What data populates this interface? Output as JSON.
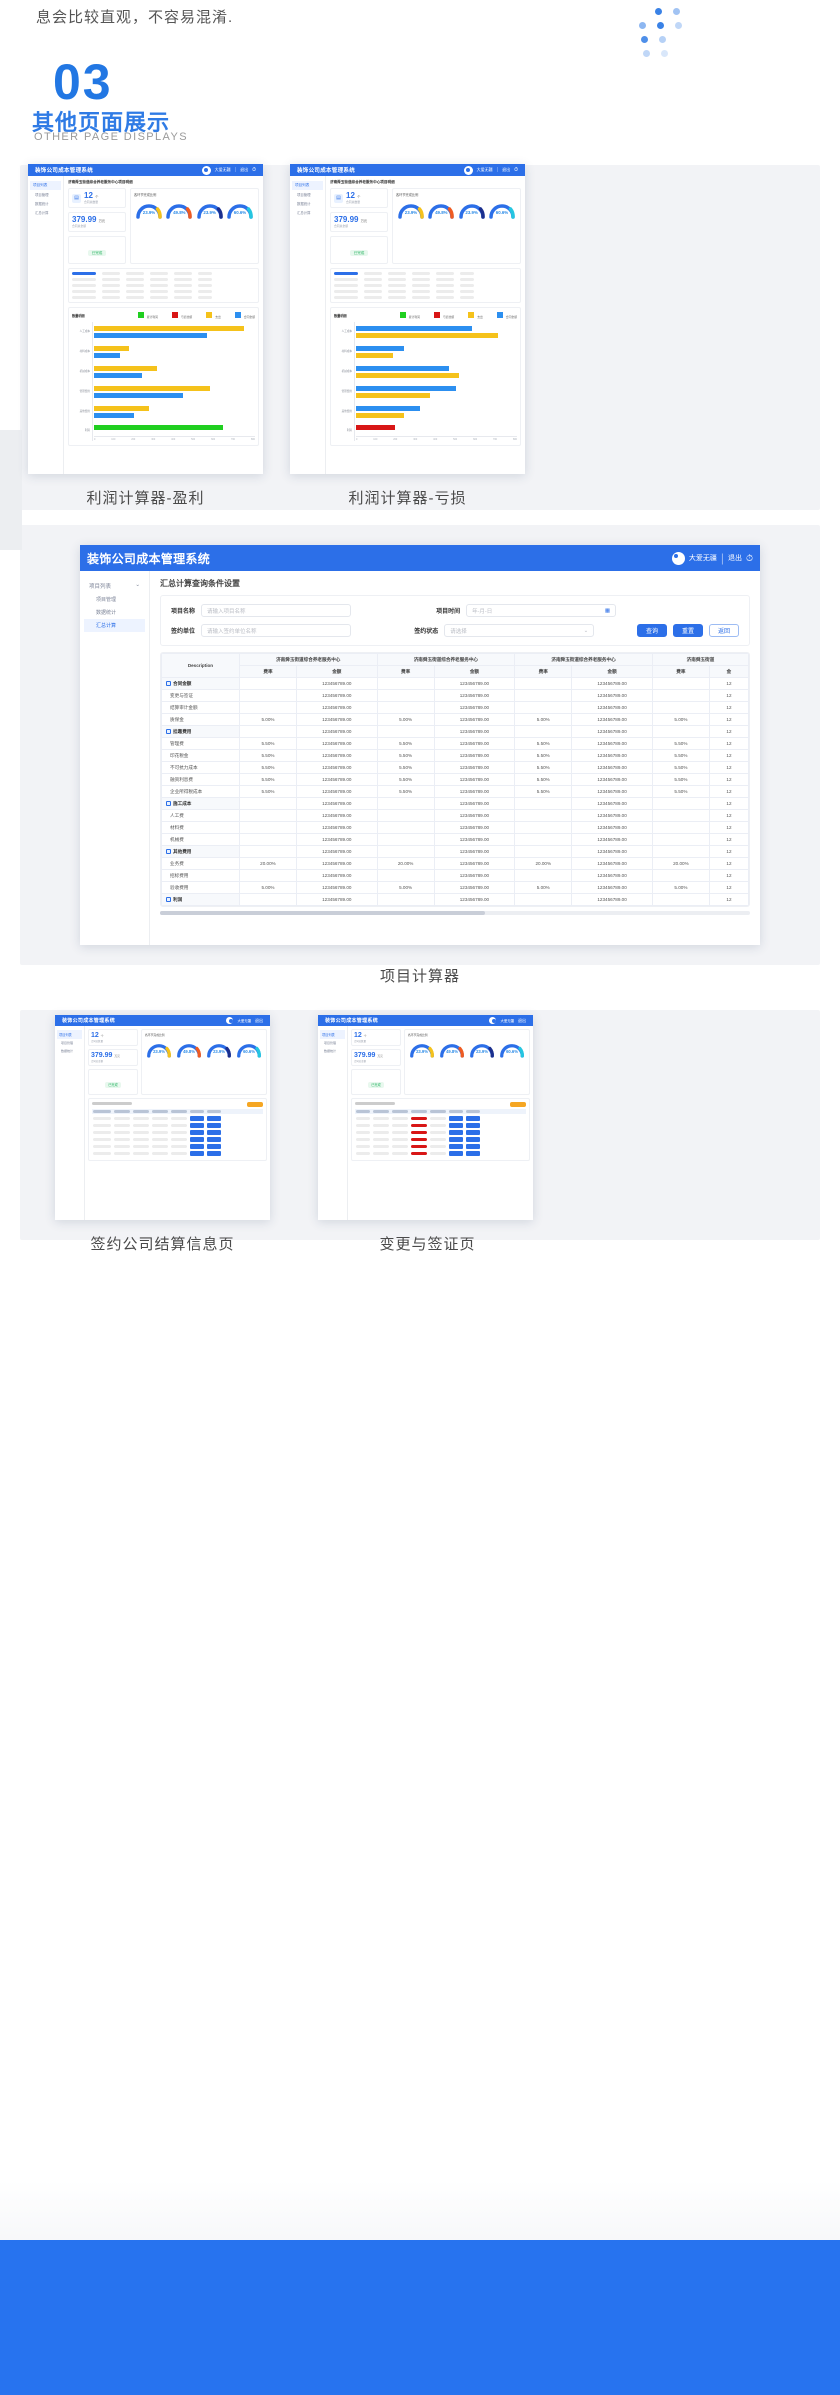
{
  "intro": {
    "text": "息会比较直观，不容易混淆."
  },
  "section": {
    "number": "03",
    "title_cn": "其他页面展示",
    "title_en": "OTHER PAGE DISPLAYS"
  },
  "app": {
    "brand": "装饰公司成本管理系统",
    "user": "大爱无疆",
    "logout": "退出",
    "page_subtitle": "济南舜玉街道综合养老服务中心项目明细",
    "stat_label_1": "合同总数量",
    "stat_value_1": "12",
    "stat_unit_1": "个",
    "stat_label_2": "合同总金额",
    "stat_value_2": "379.99",
    "stat_unit_2": "万元",
    "stat_badge": "已完成",
    "gauge_group_title": "各环节完成比例"
  },
  "sidebar": {
    "items": [
      {
        "label": "项目列表"
      },
      {
        "label": "项目管理"
      },
      {
        "label": "数据统计"
      },
      {
        "label": "汇总计算"
      }
    ],
    "active_index": 3
  },
  "gauges": [
    {
      "value": "23.9%",
      "pct": 23.9,
      "accent": "#f5c21b"
    },
    {
      "value": "49.8%",
      "pct": 49.8,
      "accent": "#ef5b21"
    },
    {
      "value": "23.9%",
      "pct": 23.9,
      "accent": "#1b2f8e"
    },
    {
      "value": "60.6%",
      "pct": 60.6,
      "accent": "#25c6e0"
    }
  ],
  "chart_data": {
    "type": "bar",
    "orientation": "horizontal",
    "title": "数量明细",
    "legend": [
      {
        "label": "累计利润",
        "color": "#20cf20"
      },
      {
        "label": "亏损金额",
        "color": "#d81616"
      },
      {
        "label": "支出",
        "color": "#f5c21b"
      },
      {
        "label": "合同金额",
        "color": "#2c8ff0"
      }
    ],
    "categories": [
      "人工成本",
      "材料成本",
      "机械成本",
      "管理费用",
      "其他费用",
      "利润"
    ],
    "xticks": [
      "0",
      "100",
      "200",
      "300",
      "400",
      "500",
      "600",
      "700",
      "800"
    ],
    "series": [
      {
        "name": "支出",
        "color": "#f5c21b",
        "values": [
          745,
          175,
          310,
          580,
          275,
          null
        ]
      },
      {
        "name": "合同金额",
        "color": "#2c8ff0",
        "values": [
          555,
          130,
          235,
          440,
          200,
          null
        ]
      },
      {
        "name": "累计利润",
        "color": "#20cf20",
        "values": [
          null,
          null,
          null,
          null,
          null,
          640
        ]
      }
    ],
    "loss_series": {
      "name": "亏损金额",
      "color": "#d81616",
      "values": [
        null,
        null,
        null,
        null,
        null,
        95
      ]
    }
  },
  "summary_form": {
    "panel_title": "汇总计算查询条件设置",
    "fields": [
      {
        "label": "项目名称",
        "placeholder": "请输入项目名称",
        "value": ""
      },
      {
        "label": "项目时间",
        "placeholder": "年-月-日",
        "value": ""
      },
      {
        "label": "签约单位",
        "placeholder": "请输入签约单位名称",
        "value": ""
      },
      {
        "label": "签约状态",
        "placeholder": "请选择",
        "value": ""
      }
    ],
    "buttons": [
      {
        "label": "查询",
        "kind": "primary"
      },
      {
        "label": "重置",
        "kind": "primary"
      },
      {
        "label": "返回",
        "kind": "ghost"
      }
    ]
  },
  "summary_table": {
    "first_col_header": "Description",
    "group_headers": [
      "济南舜玉街道综合养老服务中心",
      "济南舜玉街道综合养老服务中心",
      "济南舜玉街道综合养老服务中心",
      "济南舜玉街道"
    ],
    "sub_headers": [
      "费率",
      "金额"
    ],
    "tail_header": "金",
    "rows": [
      {
        "label": "合同金额",
        "group": true,
        "rate": "",
        "amount": "123456789.00",
        "tail": "12"
      },
      {
        "label": "变更与签证",
        "group": false,
        "rate": "",
        "amount": "123456789.00",
        "tail": "12"
      },
      {
        "label": "结算审计金额",
        "group": false,
        "rate": "",
        "amount": "123456789.00",
        "tail": "12"
      },
      {
        "label": "质保金",
        "group": false,
        "rate": "5.00%",
        "amount": "123456789.00",
        "tail": "12"
      },
      {
        "label": "挂靠费用",
        "group": true,
        "rate": "",
        "amount": "123456789.00",
        "tail": "12"
      },
      {
        "label": "管理费",
        "group": false,
        "rate": "5.50%",
        "amount": "123456789.00",
        "tail": "12"
      },
      {
        "label": "印花税金",
        "group": false,
        "rate": "5.50%",
        "amount": "123456789.00",
        "tail": "12"
      },
      {
        "label": "不可抗力成本",
        "group": false,
        "rate": "5.50%",
        "amount": "123456789.00",
        "tail": "12"
      },
      {
        "label": "融资利息费",
        "group": false,
        "rate": "5.50%",
        "amount": "123456789.00",
        "tail": "12"
      },
      {
        "label": "企业所得税成本",
        "group": false,
        "rate": "5.50%",
        "amount": "123456789.00",
        "tail": "12"
      },
      {
        "label": "施工成本",
        "group": true,
        "rate": "",
        "amount": "123456789.00",
        "tail": "12"
      },
      {
        "label": "人工费",
        "group": false,
        "rate": "",
        "amount": "123456789.00",
        "tail": "12"
      },
      {
        "label": "材料费",
        "group": false,
        "rate": "",
        "amount": "123456789.00",
        "tail": "12"
      },
      {
        "label": "机械费",
        "group": false,
        "rate": "",
        "amount": "123456789.00",
        "tail": "12"
      },
      {
        "label": "其他费用",
        "group": true,
        "rate": "",
        "amount": "123456789.00",
        "tail": "12"
      },
      {
        "label": "业务费",
        "group": false,
        "rate": "20.00%",
        "amount": "123456789.00",
        "tail": "12"
      },
      {
        "label": "招标费用",
        "group": false,
        "rate": "",
        "amount": "123456789.00",
        "tail": "12"
      },
      {
        "label": "验收费用",
        "group": false,
        "rate": "5.00%",
        "amount": "123456789.00",
        "tail": "12"
      },
      {
        "label": "利润",
        "group": true,
        "rate": "",
        "amount": "123456789.00",
        "tail": "12"
      }
    ]
  },
  "captions": {
    "c1": "利润计算器-盈利",
    "c2": "利润计算器-亏损",
    "c3": "项目计算器",
    "c4": "签约公司结算信息页",
    "c5": "变更与签证页"
  }
}
